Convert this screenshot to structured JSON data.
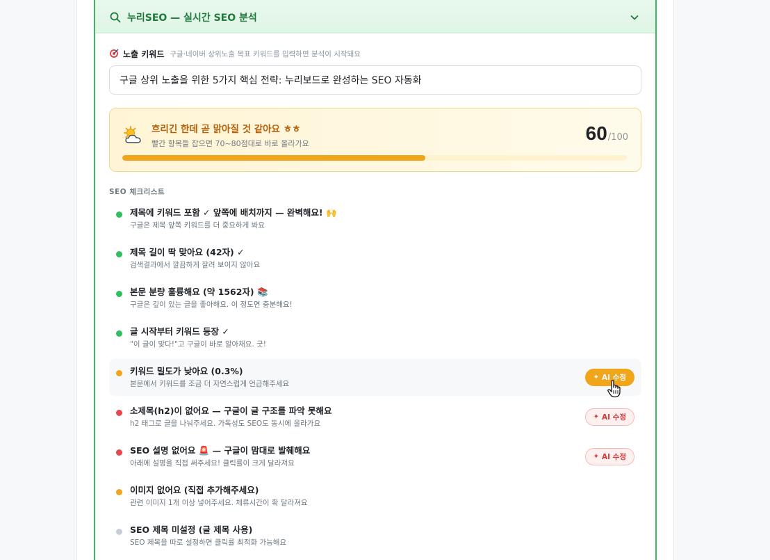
{
  "header": {
    "title": "누리SEO — 실시간 SEO 분석"
  },
  "keyword": {
    "label": "노출 키워드",
    "hint": "구글·네이버 상위노출 목표 키워드를 입력하면 분석이 시작돼요",
    "value": "구글 상위 노출을 위한 5가지 핵심 전략: 누리보드로 완성하는 SEO 자동화"
  },
  "score": {
    "headline": "흐리긴 한데 곧 맑아질 것 같아요 ㅎㅎ",
    "sub": "빨간 항목들 잡으면 70~80점대로 바로 올라가요",
    "value": "60",
    "max": "/100",
    "progress_fraction": 0.6
  },
  "checklist": {
    "label": "SEO 체크리스트",
    "items": [
      {
        "status": "green",
        "title": "제목에 키워드 포함 ✓ 앞쪽에 배치까지 — 완벽해요! 🙌",
        "desc": "구글은 제목 앞쪽 키워드를 더 중요하게 봐요",
        "ai": ""
      },
      {
        "status": "green",
        "title": "제목 길이 딱 맞아요 (42자) ✓",
        "desc": "검색결과에서 깔끔하게 잘려 보이지 않아요",
        "ai": ""
      },
      {
        "status": "green",
        "title": "본문 분량 훌륭해요 (약 1562자) 📚",
        "desc": "구글은 깊이 있는 글을 좋아해요. 이 정도면 충분해요!",
        "ai": ""
      },
      {
        "status": "green",
        "title": "글 시작부터 키워드 등장 ✓",
        "desc": "\"이 글이 맞다!\"고 구글이 바로 알아채요. 굿!",
        "ai": ""
      },
      {
        "status": "orange",
        "title": "키워드 밀도가 낮아요 (0.3%)",
        "desc": "본문에서 키워드를 조금 더 자연스럽게 언급해주세요",
        "ai": "AI 수정"
      },
      {
        "status": "red",
        "title": "소제목(h2)이 없어요 — 구글이 글 구조를 파악 못해요",
        "desc": "h2 태그로 글을 나눠주세요. 가독성도 SEO도 동시에 올라가요",
        "ai": "AI 수정"
      },
      {
        "status": "red",
        "title": "SEO 설명 없어요 🚨 — 구글이 맘대로 발췌해요",
        "desc": "아래에 설명을 직접 써주세요! 클릭률이 크게 달라져요",
        "ai": "AI 수정"
      },
      {
        "status": "orange",
        "title": "이미지 없어요 (직접 추가해주세요)",
        "desc": "관련 이미지 1개 이상 넣어주세요. 체류시간이 확 달라져요",
        "ai": ""
      },
      {
        "status": "gray",
        "title": "SEO 제목 미설정 (글 제목 사용)",
        "desc": "SEO 제목을 따로 설정하면 클릭률 최적화 가능해요",
        "ai": ""
      }
    ]
  },
  "colors": {
    "accent_green": "#3cb55e",
    "warning_orange": "#f0a51a",
    "error_red": "#e5484d",
    "neutral_gray": "#c9ced4"
  },
  "icons": {
    "header": "search-icon",
    "collapse": "chevron-down-icon",
    "keyword": "target-icon",
    "score": "sun-behind-cloud-icon",
    "ai_button": "sparkle-icon",
    "cursor": "hand-pointer-icon"
  }
}
